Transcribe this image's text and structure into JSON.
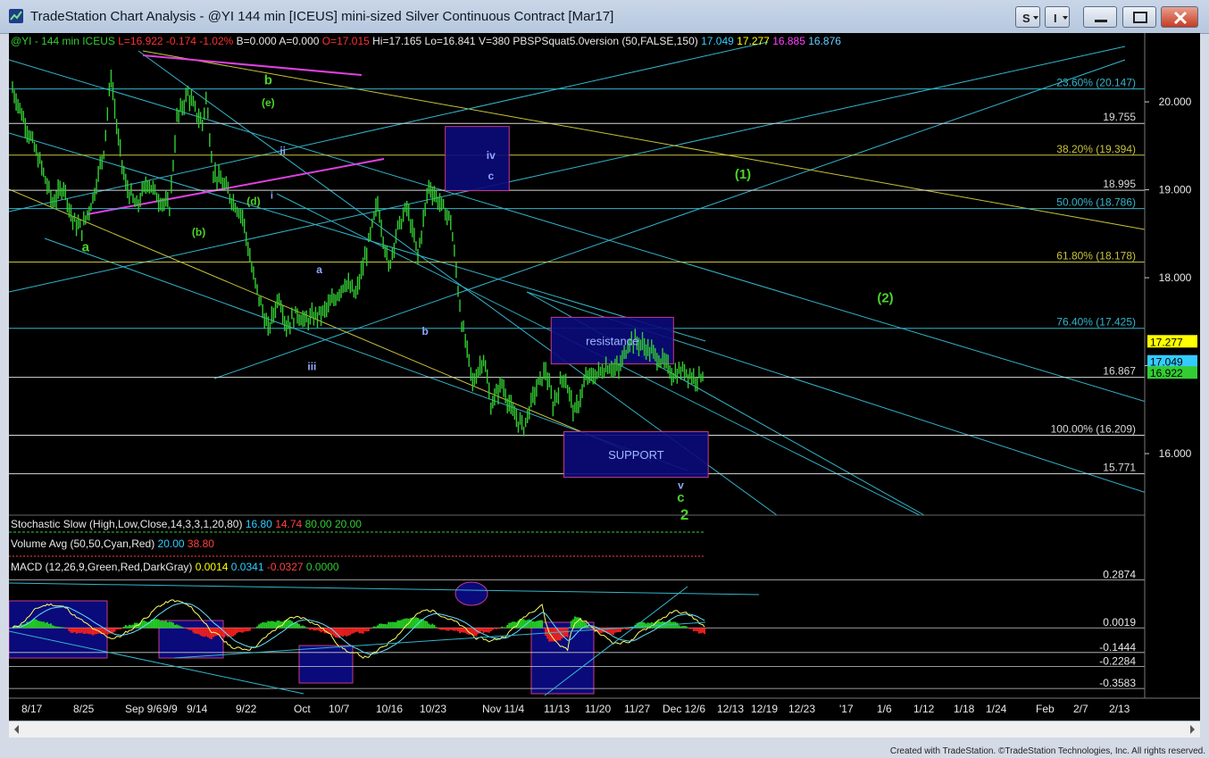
{
  "window": {
    "title": "TradeStation Chart Analysis - @YI 144 min [ICEUS] mini-sized Silver Continuous Contract [Mar17]",
    "footer": "Created with TradeStation. ©TradeStation Technologies, Inc. All rights reserved."
  },
  "colors": {
    "background": "#000000",
    "price_bars": "#33cc33",
    "cyan": "#33b5cc",
    "yellow": "#c8c23a",
    "magenta": "#e040e0",
    "box_fill": "#0a0a7a",
    "green_label": "#4cd32a",
    "white_line": "#d8d8d8",
    "blue_label": "#8ea8ff"
  },
  "header": {
    "symbol": "@YI - 144 min  ICEUS",
    "last": "L=16.922",
    "change": "-0.174",
    "pct": "-1.02%",
    "bid": "B=0.000",
    "ask": "A=0.000",
    "open": "O=17.015",
    "high": "Hi=17.165",
    "low": "Lo=16.841",
    "volume": "V=380",
    "study": "PBSPSquat5.0version (50,FALSE,150)",
    "v1": "17.049",
    "v2": "17.277",
    "v3": "16.885",
    "v4": "16.876"
  },
  "chart_data": {
    "type": "line",
    "price_axis": {
      "min": 15.3,
      "max": 20.6,
      "ticks": [
        16.0,
        17.0,
        18.0,
        19.0,
        20.0
      ],
      "tick_labels": [
        "16.000",
        "17.000",
        "18.000",
        "19.000",
        "20.000"
      ]
    },
    "x_tick_labels": [
      "8/17",
      "8/25",
      "Sep 9/6",
      "9/9",
      "9/14",
      "9/22",
      "Oct",
      "10/7",
      "10/16",
      "10/23",
      "Nov 11/4",
      "11/13",
      "11/20",
      "11/27",
      "Dec 12/6",
      "12/13",
      "12/19",
      "12/23",
      "'17",
      "1/6",
      "1/12",
      "1/18",
      "1/24",
      "Feb",
      "2/7",
      "2/13"
    ],
    "price_path_bars": [
      0,
      8,
      16,
      22,
      28,
      33,
      38,
      44,
      50,
      54,
      58,
      62,
      68,
      74,
      80,
      86,
      90,
      96,
      100,
      104,
      106,
      110,
      116,
      120,
      126,
      132,
      140,
      146,
      150,
      156,
      160,
      164,
      170,
      176,
      182,
      188,
      194,
      200,
      206,
      210,
      216,
      222,
      228,
      234,
      240,
      246,
      252,
      258,
      262,
      268,
      274,
      280,
      286,
      292,
      296,
      302,
      308,
      314,
      320,
      326,
      332,
      338,
      344,
      350,
      356,
      362,
      368,
      374,
      378
    ],
    "price_path": [
      20.15,
      19.7,
      19.25,
      18.85,
      19.05,
      18.65,
      18.55,
      18.9,
      19.45,
      20.3,
      19.55,
      19.05,
      18.8,
      19.1,
      18.9,
      18.8,
      19.8,
      20.1,
      19.9,
      19.75,
      20.05,
      19.2,
      19.05,
      18.9,
      18.7,
      18.0,
      17.4,
      17.8,
      17.45,
      17.6,
      17.5,
      17.55,
      17.6,
      17.75,
      17.95,
      17.8,
      18.3,
      18.85,
      18.1,
      18.5,
      18.8,
      18.25,
      19.05,
      18.85,
      18.65,
      17.5,
      16.8,
      17.1,
      16.55,
      16.8,
      16.45,
      16.3,
      16.7,
      16.95,
      16.55,
      16.9,
      16.45,
      16.85,
      16.9,
      17.0,
      16.95,
      17.3,
      17.25,
      17.15,
      17.05,
      16.9,
      16.95,
      16.85,
      16.92
    ],
    "horizontal_levels": [
      {
        "label": "23.60% (20.147)",
        "value": 20.147,
        "color": "cyan"
      },
      {
        "label": "19.755",
        "value": 19.755,
        "color": "white"
      },
      {
        "label": "38.20% (19.394)",
        "value": 19.394,
        "color": "yellow"
      },
      {
        "label": "18.995",
        "value": 18.995,
        "color": "white"
      },
      {
        "label": "50.00% (18.786)",
        "value": 18.786,
        "color": "cyan"
      },
      {
        "label": "61.80% (18.178)",
        "value": 18.178,
        "color": "yellow"
      },
      {
        "label": "76.40% (17.425)",
        "value": 17.425,
        "color": "cyan"
      },
      {
        "label": "16.867",
        "value": 16.867,
        "color": "white"
      },
      {
        "label": "100.00% (16.209)",
        "value": 16.209,
        "color": "white"
      },
      {
        "label": "15.771",
        "value": 15.771,
        "color": "white"
      }
    ],
    "price_tags": [
      {
        "label": "17.277",
        "value": 17.277,
        "bg": "#ffff00",
        "fg": "#000000"
      },
      {
        "label": "17.049",
        "value": 17.049,
        "bg": "#33ccff",
        "fg": "#000000"
      },
      {
        "label": "16.922",
        "value": 16.922,
        "bg": "#33cc33",
        "fg": "#000000"
      }
    ],
    "zones": [
      {
        "label": "",
        "bar_start": 237,
        "bar_end": 272,
        "price_low": 18.99,
        "price_high": 19.72
      },
      {
        "label": "resistance",
        "bar_start": 295,
        "bar_end": 362,
        "price_low": 17.02,
        "price_high": 17.55
      },
      {
        "label": "SUPPORT",
        "bar_start": 302,
        "bar_end": 381,
        "price_low": 15.73,
        "price_high": 16.25
      }
    ],
    "wave_labels": [
      {
        "text": "a",
        "bar": 40,
        "price": 18.3,
        "color": "green_label",
        "size": 15
      },
      {
        "text": "b",
        "bar": 140,
        "price": 20.2,
        "color": "green_label",
        "size": 15
      },
      {
        "text": "(e)",
        "bar": 140,
        "price": 19.95,
        "color": "green_label",
        "size": 12
      },
      {
        "text": "(b)",
        "bar": 102,
        "price": 18.48,
        "color": "green_label",
        "size": 12
      },
      {
        "text": "(d)",
        "bar": 132,
        "price": 18.83,
        "color": "green_label",
        "size": 12
      },
      {
        "text": "ii",
        "bar": 148,
        "price": 19.4,
        "color": "blue_label",
        "size": 12
      },
      {
        "text": "i",
        "bar": 142,
        "price": 18.9,
        "color": "blue_label",
        "size": 11
      },
      {
        "text": "a",
        "bar": 168,
        "price": 18.05,
        "color": "blue_label",
        "size": 12
      },
      {
        "text": "b",
        "bar": 226,
        "price": 17.35,
        "color": "blue_label",
        "size": 12
      },
      {
        "text": "iii",
        "bar": 164,
        "price": 16.95,
        "color": "blue_label",
        "size": 12
      },
      {
        "text": "iv",
        "bar": 262,
        "price": 19.35,
        "color": "blue_label",
        "size": 12
      },
      {
        "text": "c",
        "bar": 262,
        "price": 19.12,
        "color": "blue_label",
        "size": 12
      },
      {
        "text": "v",
        "bar": 366,
        "price": 15.6,
        "color": "blue_label",
        "size": 12
      },
      {
        "text": "c",
        "bar": 366,
        "price": 15.45,
        "color": "green_label",
        "size": 15
      },
      {
        "text": "2",
        "bar": 368,
        "price": 15.25,
        "color": "green_label",
        "size": 17
      },
      {
        "text": "(1)",
        "bar": 400,
        "price": 19.13,
        "color": "green_label",
        "size": 15
      },
      {
        "text": "(2)",
        "bar": 478,
        "price": 17.72,
        "color": "green_label",
        "size": 15
      }
    ],
    "indicators": {
      "stochastic": {
        "label": "Stochastic Slow (High,Low,Close,14,3,3,1,20,80)",
        "v1": "16.80",
        "v2": "14.74",
        "v3": "80.00",
        "v4": "20.00",
        "tag1": "16.80",
        "tag2": "20"
      },
      "volume": {
        "label": "Volume Avg (50,50,Cyan,Red)",
        "v1": "20.00",
        "v2": "38.80"
      },
      "macd": {
        "label": "MACD (12,26,9,Green,Red,DarkGray)",
        "v1": "0.0014",
        "v2": "0.0341",
        "v3": "-0.0327",
        "v4": "0.0000",
        "axis_ticks": [
          "0.1000",
          "-0.1000",
          "-0.3000"
        ],
        "level_labels": [
          "0.2874",
          "0.0019",
          "-0.1444",
          "-0.2284",
          "-0.3583"
        ],
        "tag": "-0.0327"
      }
    }
  }
}
